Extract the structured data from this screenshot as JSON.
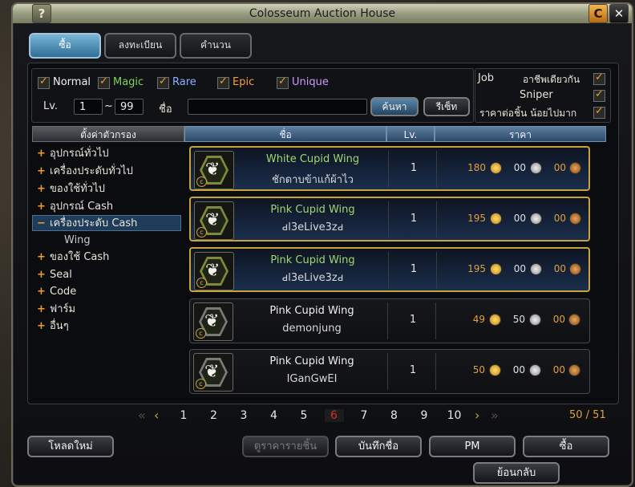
{
  "window": {
    "title": "Colosseum Auction House",
    "help": "?",
    "cash": "C",
    "close": "✕"
  },
  "tabs": [
    {
      "label": "ซื้อ"
    },
    {
      "label": "ลงทะเบียน"
    },
    {
      "label": "คำนวน"
    }
  ],
  "filters": {
    "grades": [
      {
        "label": "Normal",
        "color": "#f0f0f0"
      },
      {
        "label": "Magic",
        "color": "#7fd35a"
      },
      {
        "label": "Rare",
        "color": "#8ab0ff"
      },
      {
        "label": "Epic",
        "color": "#f0a040"
      },
      {
        "label": "Unique",
        "color": "#c89aff"
      }
    ],
    "lv_label": "Lv.",
    "lv_min": "1",
    "lv_sep": "~",
    "lv_max": "99",
    "name_label": "ชื่อ",
    "name_value": "",
    "search": "ค้นหา",
    "reset": "รีเซ็ท"
  },
  "job": {
    "label": "Job",
    "same_job": "อาชีพเดียวกัน",
    "class": "Sniper",
    "sort": "ราคาต่อชิ้น น้อยไปมาก"
  },
  "headers": {
    "category": "ตั้งค่าตัวกรอง",
    "name": "ชื่อ",
    "lv": "Lv.",
    "price": "ราคา"
  },
  "categories": [
    {
      "pm": "+",
      "label": "อุปกรณ์ทั่วไป"
    },
    {
      "pm": "+",
      "label": "เครื่องประดับทั่วไป"
    },
    {
      "pm": "+",
      "label": "ของใช้ทั่วไป"
    },
    {
      "pm": "+",
      "label": "อุปกรณ์ Cash"
    },
    {
      "pm": "−",
      "label": "เครื่องประดับ Cash"
    },
    {
      "pm": "",
      "label": "Wing"
    },
    {
      "pm": "+",
      "label": "ของใช้ Cash"
    },
    {
      "pm": "+",
      "label": "Seal"
    },
    {
      "pm": "+",
      "label": "Code"
    },
    {
      "pm": "+",
      "label": "ฟาร์ม"
    },
    {
      "pm": "+",
      "label": "อื่นๆ"
    }
  ],
  "items": [
    {
      "name": "White Cupid Wing",
      "name_color": "#9ed870",
      "seller": "ชักดาบข้าแก้ผ้าไว",
      "lv": "1",
      "gold": "180",
      "silver": "00",
      "copper": "00",
      "style": "gold",
      "icon": "wing-icon"
    },
    {
      "name": "Pink Cupid Wing",
      "name_color": "#9ed870",
      "seller": "ԁl3eLive3zԁ",
      "lv": "1",
      "gold": "195",
      "silver": "00",
      "copper": "00",
      "style": "gold",
      "icon": "wing-icon"
    },
    {
      "name": "Pink Cupid Wing",
      "name_color": "#9ed870",
      "seller": "ԁl3eLive3zԁ",
      "lv": "1",
      "gold": "195",
      "silver": "00",
      "copper": "00",
      "style": "gold",
      "icon": "wing-icon"
    },
    {
      "name": "Pink Cupid Wing",
      "name_color": "#f0f0f0",
      "seller": "demonjung",
      "lv": "1",
      "gold": "49",
      "silver": "50",
      "copper": "00",
      "style": "plain",
      "icon": "wing-icon"
    },
    {
      "name": "Pink Cupid Wing",
      "name_color": "#f0f0f0",
      "seller": "IGanGwEI",
      "lv": "1",
      "gold": "50",
      "silver": "00",
      "copper": "00",
      "style": "plain",
      "icon": "wing-icon"
    }
  ],
  "pagination": {
    "pages": [
      "1",
      "2",
      "3",
      "4",
      "5",
      "6",
      "7",
      "8",
      "9",
      "10"
    ],
    "current": "6",
    "count": "50 / 51"
  },
  "footer": {
    "load": "โหลดใหม่",
    "price_history": "ดูราคารายชิ้น",
    "save_name": "บันทึกชื่อ",
    "pm": "PM",
    "buy": "ซื้อ",
    "back": "ย้อนกลับ"
  }
}
